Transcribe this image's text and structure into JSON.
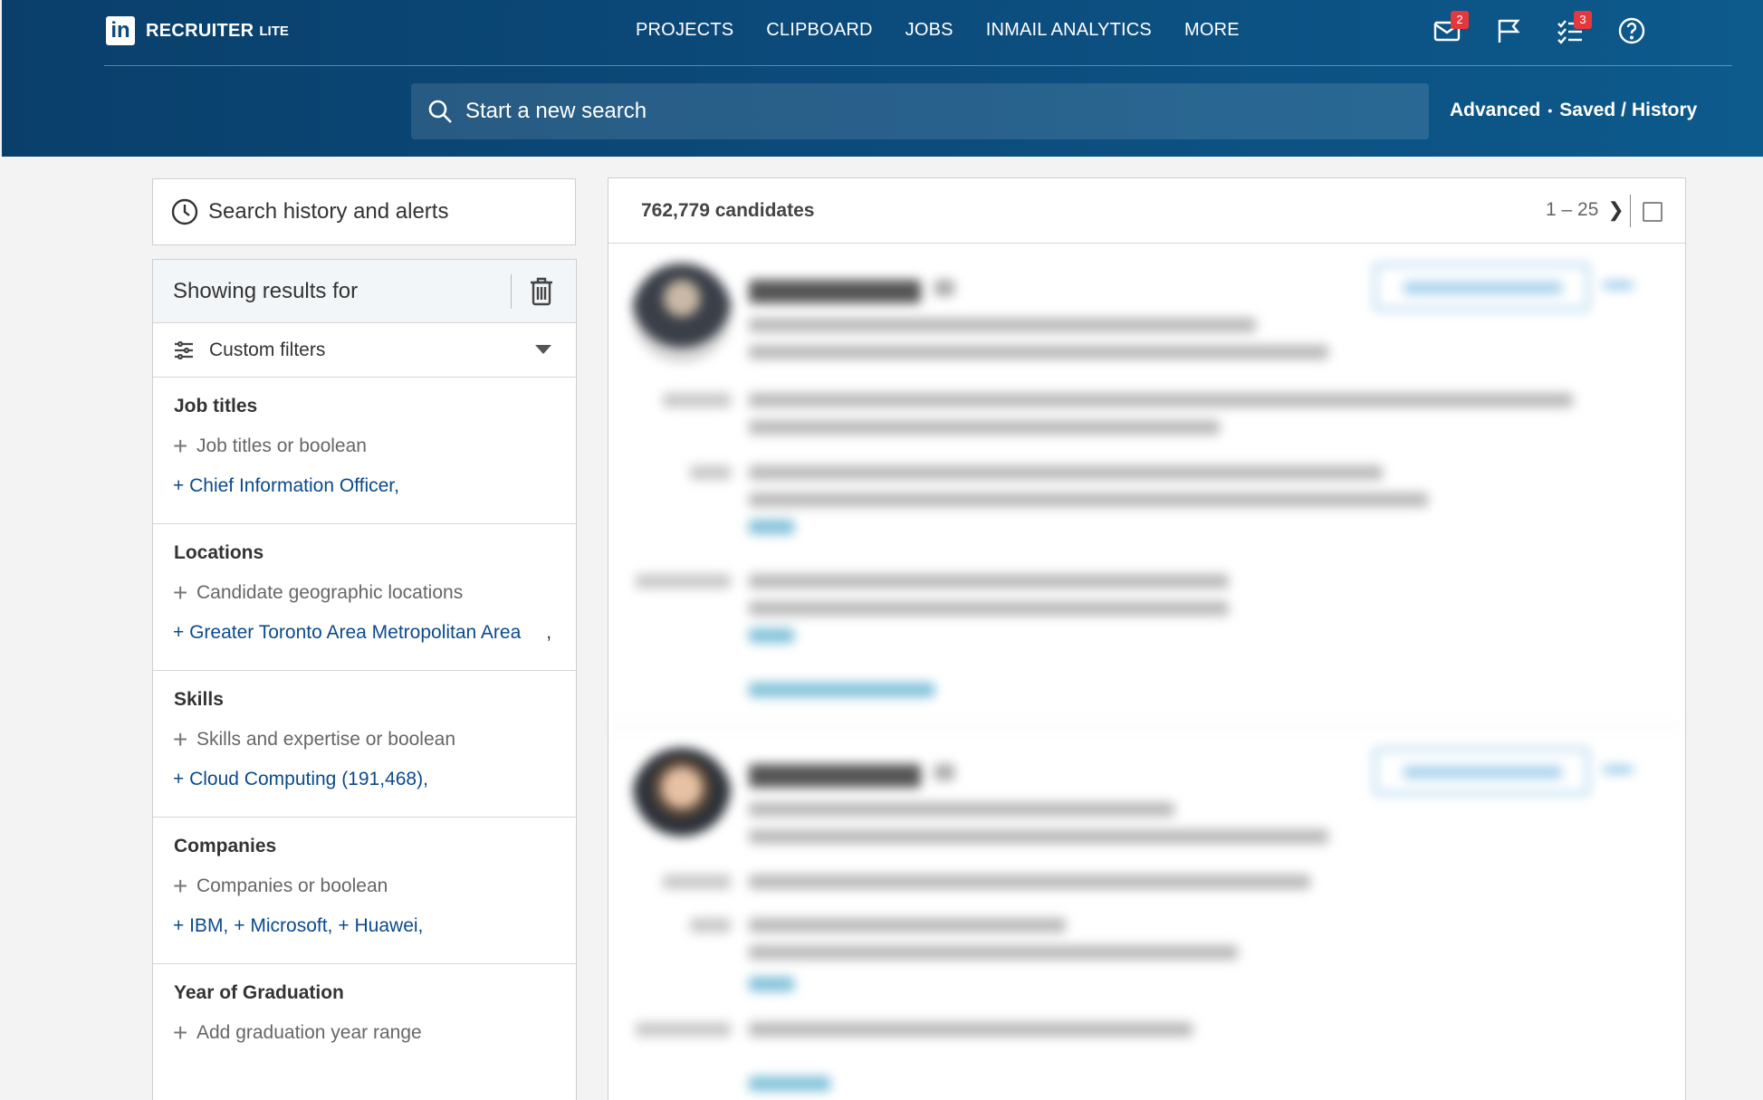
{
  "header": {
    "brand": "RECRUITER",
    "brand_sub": "LITE",
    "logo_text": "in",
    "nav": [
      "PROJECTS",
      "CLIPBOARD",
      "JOBS",
      "INMAIL ANALYTICS",
      "MORE"
    ],
    "messages_badge": "2",
    "tasks_badge": "3",
    "search_placeholder": "Start a new search",
    "link_advanced": "Advanced",
    "separator_dot": "•",
    "link_saved": "Saved",
    "link_slash": "/",
    "link_history": "History"
  },
  "sidebar": {
    "history_label": "Search history and alerts",
    "showing_label": "Showing results for",
    "custom_filters_label": "Custom filters",
    "sections": [
      {
        "title": "Job titles",
        "add_label": "Job titles or boolean",
        "chips": [
          "+ Chief Information Officer,"
        ]
      },
      {
        "title": "Locations",
        "add_label": "Candidate geographic locations",
        "chips": [
          "+ Greater Toronto Area Metropolitan Area",
          ","
        ]
      },
      {
        "title": "Skills",
        "add_label": "Skills and expertise or boolean",
        "chips": [
          "+ Cloud Computing (191,468),"
        ]
      },
      {
        "title": "Companies",
        "add_label": "Companies or boolean",
        "chips": [
          "+ IBM,",
          "+ Microsoft,",
          "+ Huawei,"
        ]
      },
      {
        "title": "Year of Graduation",
        "add_label": "Add graduation year range",
        "chips": []
      }
    ]
  },
  "results": {
    "count_label": "762,779 candidates",
    "pager_label": "1 – 25",
    "pager_next": "❯"
  },
  "icons": {
    "messages": "envelope-icon",
    "flag": "flag-icon",
    "tasks": "checklist-icon",
    "help": "help-icon",
    "search": "search-icon",
    "history": "clock-icon",
    "trash": "trash-icon",
    "filters": "sliders-icon"
  },
  "colors": {
    "header_bg": "#0b4a7a",
    "badge": "#e3393c",
    "link": "#0b4a8b"
  }
}
